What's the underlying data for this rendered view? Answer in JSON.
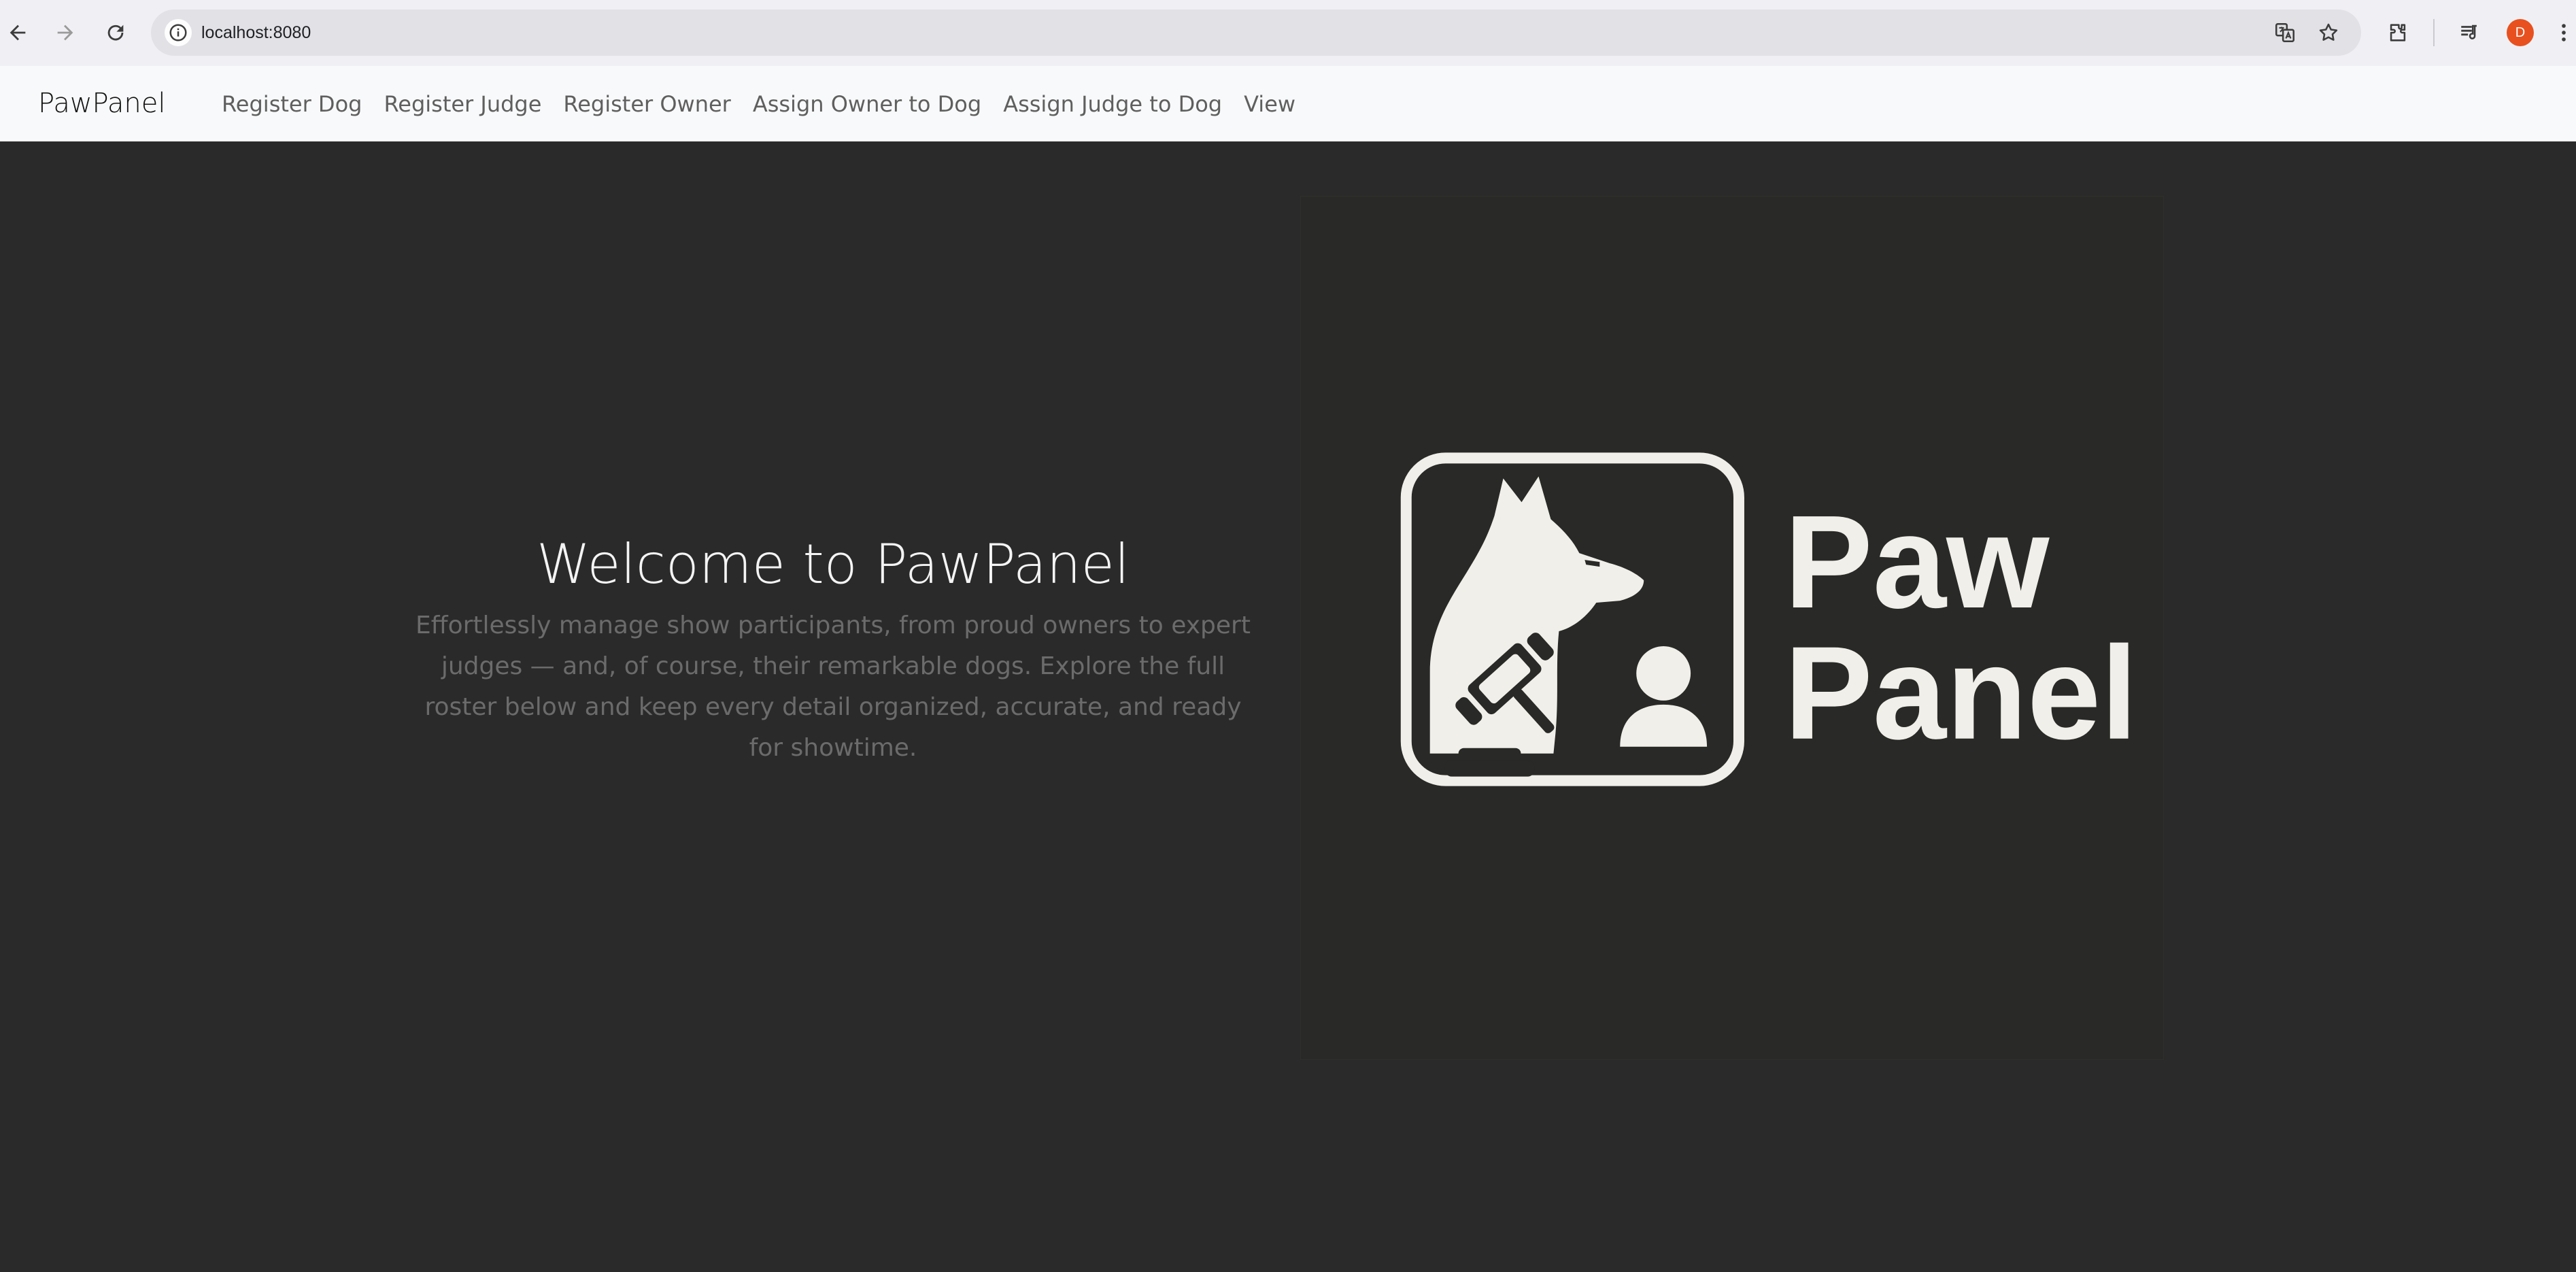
{
  "browser": {
    "url": "localhost:8080",
    "profile_initial": "D",
    "avatar_color": "#e8501f"
  },
  "navbar": {
    "brand": "PawPanel",
    "links": [
      {
        "label": "Register Dog"
      },
      {
        "label": "Register Judge"
      },
      {
        "label": "Register Owner"
      },
      {
        "label": "Assign Owner to Dog"
      },
      {
        "label": "Assign Judge to Dog"
      },
      {
        "label": "View"
      }
    ]
  },
  "hero": {
    "title": "Welcome to PawPanel",
    "subtitle": "Effortlessly manage show participants, from proud owners to expert judges — and, of course, their remarkable dogs. Explore the full roster below and keep every detail organized, accurate, and ready for showtime.",
    "logo": {
      "line1": "Paw",
      "line2": "Panel",
      "icons": [
        "dog-head-icon",
        "gavel-icon",
        "person-icon"
      ]
    }
  },
  "colors": {
    "page_bg": "#2a2a2a",
    "navbar_bg": "#f8f9fa",
    "logo_fg": "#f1efe9",
    "subtitle": "#6b6b6b"
  }
}
